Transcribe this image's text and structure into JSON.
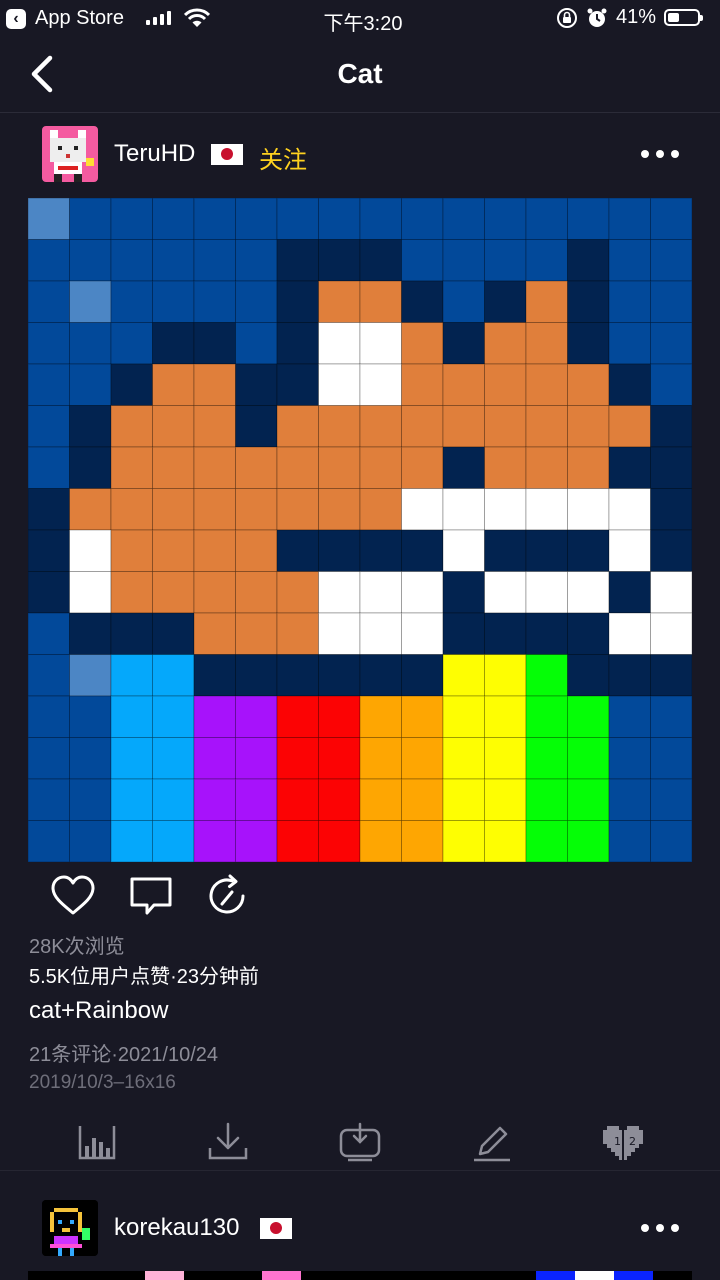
{
  "status_bar": {
    "back_app": "App Store",
    "time": "下午3:20",
    "battery": "41%",
    "battery_level": 0.41
  },
  "nav": {
    "title": "Cat"
  },
  "post": {
    "username": "TeruHD",
    "follow_label": "关注",
    "views": "28K次浏览",
    "likes_time": "5.5K位用户点赞·23分钟前",
    "caption": "cat+Rainbow",
    "comments_date": "21条评论·2021/10/24",
    "meta": "2019/10/3–16x16",
    "pixel_art": {
      "palette": {
        "A": "#02499a",
        "B": "#022350",
        "L": "#4c86c5",
        "O": "#e07f3b",
        "W": "#ffffff",
        "C": "#05a8fb",
        "P": "#a712fb",
        "R": "#fc0304",
        "Y": "#fea602",
        "U": "#fefe02",
        "G": "#05fe06"
      },
      "rows": [
        "LAAAAAAAAAAAAAAA",
        "AAAAAABBBAAAABAA",
        "ALAAAABOOBABOBAA",
        "AAABBABWWOBOOBAA",
        "AABOOBBWWOOOOOBA",
        "ABOOOBOOOOOOOOOB",
        "ABOOOOOOOOBOOOBB",
        "BOOOOOOOOWWWWWWB",
        "BWOOOOBBBBWBBBWB",
        "BWOOOOOWWWBWWWBW",
        "ABBBOOOWWWBBBBWW",
        "ALCCBBBBBBUUGBBB",
        "AACCPPRRYYUUGGAA",
        "AACCPPRRYYUUGGAA",
        "AACCPPRRYYUUGGAA",
        "AACCPPRRYYUUGGAA"
      ]
    }
  },
  "next_post": {
    "username": "korekau130",
    "strip_colors": [
      "#000000",
      "#000000",
      "#000000",
      "#ffb2d8",
      "#000000",
      "#000000",
      "#ff74cf",
      "#000000",
      "#000000",
      "#000000",
      "#000000",
      "#000000",
      "#000000",
      "#0a24ff",
      "#ffffff",
      "#0a24ff",
      "#000000"
    ]
  },
  "icons": {
    "nav_back": "chevron-left-icon",
    "like": "heart-icon",
    "comment": "comment-icon",
    "repost": "repost-icon",
    "stats": "bar-chart-icon",
    "download": "download-icon",
    "save_tv": "tv-download-icon",
    "edit": "pencil-icon",
    "heart_badge": "pixel-heart-icon"
  }
}
